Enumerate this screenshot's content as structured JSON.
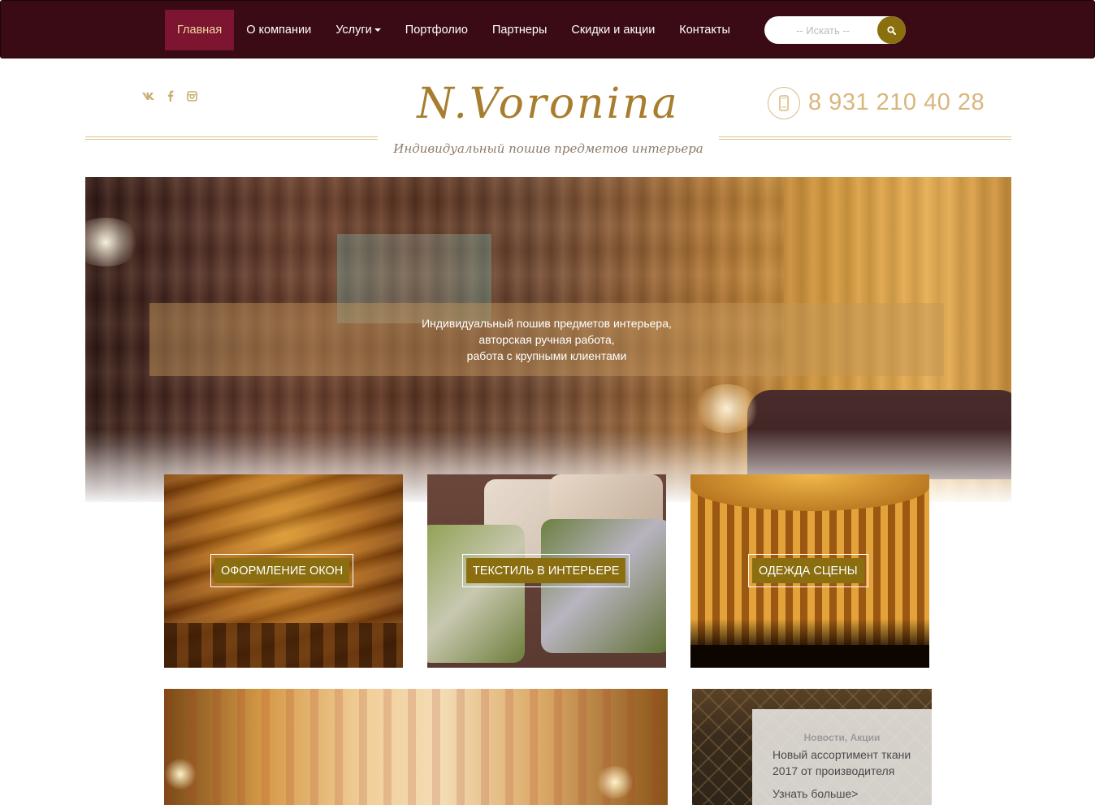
{
  "nav": {
    "items": [
      {
        "label": "Главная",
        "active": true
      },
      {
        "label": "О компании"
      },
      {
        "label": "Услуги",
        "dropdown": true
      },
      {
        "label": "Портфолио"
      },
      {
        "label": "Партнеры"
      },
      {
        "label": "Скидки и акции"
      },
      {
        "label": "Контакты"
      }
    ],
    "search_placeholder": "-- Искать --",
    "search_icon": "search-icon"
  },
  "header": {
    "social_icons": [
      "vk-icon",
      "facebook-icon",
      "instagram-icon"
    ],
    "logo_main": "N.Voronina",
    "logo_sub": "Индивидуальный пошив предметов интерьера",
    "phone": "8 931 210 40 28",
    "phone_icon": "mobile-phone-icon"
  },
  "hero": {
    "caption_lines": [
      "Индивидуальный пошив предметов интерьера,",
      "авторская ручная работа,",
      "работа с крупными клиентами"
    ]
  },
  "tiles": [
    {
      "label": "ОФОРМЛЕНИЕ ОКОН"
    },
    {
      "label": "ТЕКСТИЛЬ В ИНТЕРЬЕРЕ"
    },
    {
      "label": "ОДЕЖДА СЦЕНЫ"
    }
  ],
  "news": {
    "category": "Новости, Акции",
    "title": "Новый ассортимент ткани 2017 от производителя",
    "link": "Узнать больше>"
  },
  "colors": {
    "navbar_bg": "#3a0b14",
    "nav_active_bg": "#7d1430",
    "accent_gold": "#8a6e10",
    "phone_text": "#d9b67c",
    "logo_gold": "#a87d2e"
  }
}
